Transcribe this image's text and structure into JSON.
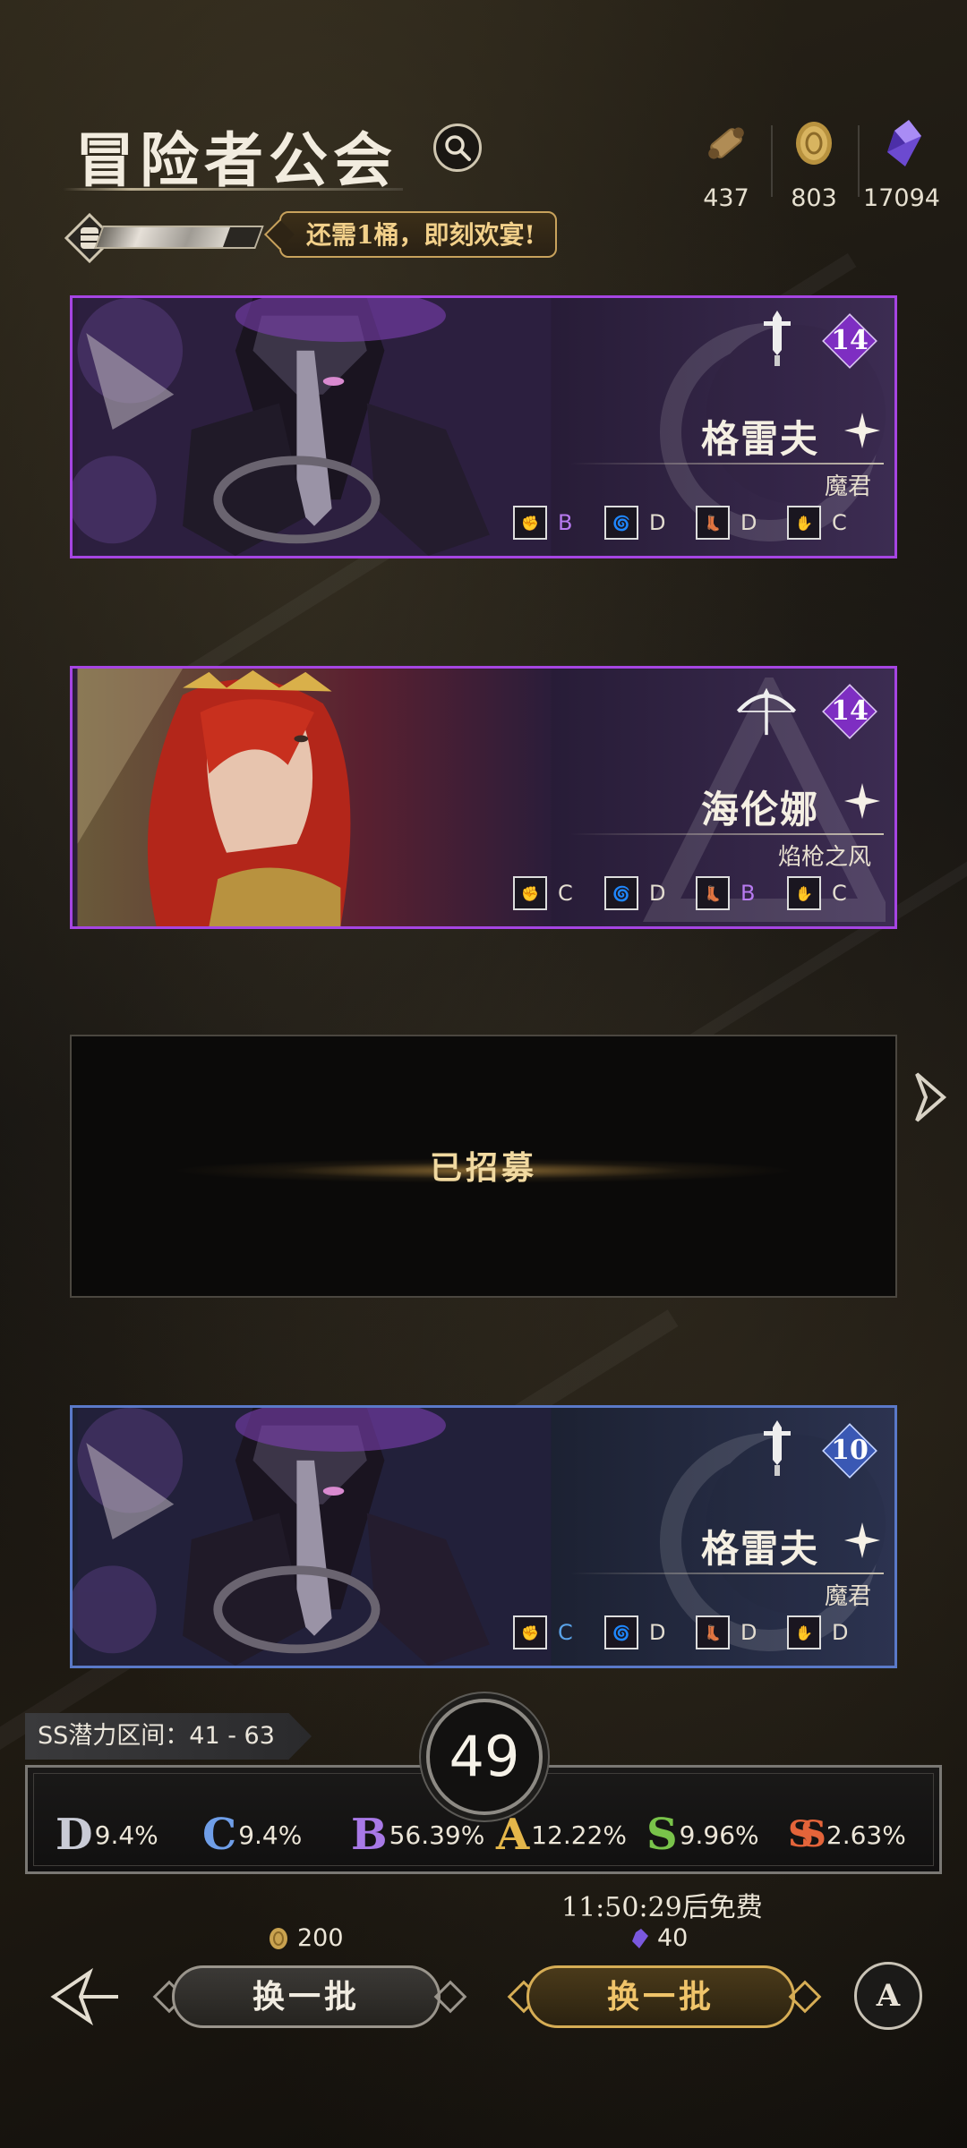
{
  "header": {
    "title": "冒险者公会",
    "notice": "还需1桶，即刻欢宴!",
    "progress_fraction": 0.8
  },
  "resources": [
    {
      "icon": "scroll-icon",
      "value": "437"
    },
    {
      "icon": "coin-icon",
      "value": "803"
    },
    {
      "icon": "crystal-icon",
      "value": "17094"
    }
  ],
  "cards": [
    {
      "name": "格雷夫",
      "title": "魔君",
      "level": "14",
      "rarity": "purple",
      "weapon": "dagger-icon",
      "stats": [
        {
          "icon": "fist-icon",
          "grade": "B"
        },
        {
          "icon": "vortex-icon",
          "grade": "D"
        },
        {
          "icon": "boot-icon",
          "grade": "D"
        },
        {
          "icon": "heart-hand-icon",
          "grade": "C"
        }
      ]
    },
    {
      "name": "海伦娜",
      "title": "焰枪之风",
      "level": "14",
      "rarity": "purple",
      "weapon": "bow-icon",
      "stats": [
        {
          "icon": "fist-icon",
          "grade": "C"
        },
        {
          "icon": "vortex-icon",
          "grade": "D"
        },
        {
          "icon": "boot-icon",
          "grade": "B"
        },
        {
          "icon": "heart-hand-icon",
          "grade": "C"
        }
      ]
    },
    {
      "recruited_label": "已招募"
    },
    {
      "name": "格雷夫",
      "title": "魔君",
      "level": "10",
      "rarity": "blue",
      "weapon": "dagger-icon",
      "stats": [
        {
          "icon": "fist-icon",
          "grade": "C"
        },
        {
          "icon": "vortex-icon",
          "grade": "D"
        },
        {
          "icon": "boot-icon",
          "grade": "D"
        },
        {
          "icon": "heart-hand-icon",
          "grade": "D"
        }
      ]
    }
  ],
  "potential": {
    "label": "SS潜力区间：41 - 63",
    "count": "49",
    "rates": [
      {
        "grade": "D",
        "pct": "9.4%",
        "color": "#c9cbd6"
      },
      {
        "grade": "C",
        "pct": "9.4%",
        "color": "#6f9ee8"
      },
      {
        "grade": "B",
        "pct": "56.39%",
        "color": "#a879e6"
      },
      {
        "grade": "A",
        "pct": "12.22%",
        "color": "#e4b64a"
      },
      {
        "grade": "S",
        "pct": "9.96%",
        "color": "#79c34a"
      },
      {
        "grade": "SS",
        "pct": "2.63%",
        "color": "#e4643a"
      }
    ]
  },
  "footer": {
    "timer": "11:50:29后免费",
    "cost_gold": "200",
    "cost_crystal": "40",
    "refresh_label_1": "换一批",
    "refresh_label_2": "换一批",
    "auto_label": "A"
  },
  "colors": {
    "purple_border": "#a645e3",
    "blue_border": "#5a79c8",
    "gold": "#d6ad55"
  }
}
